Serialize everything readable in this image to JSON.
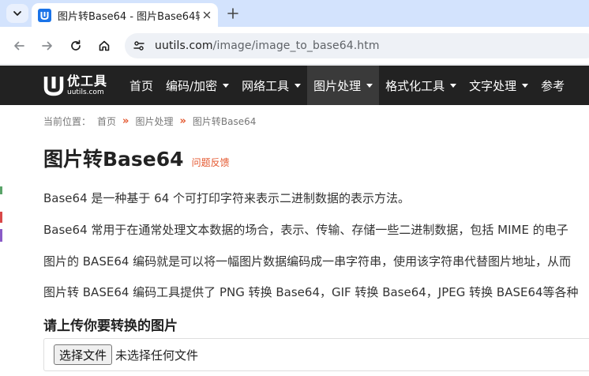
{
  "browser": {
    "tab": {
      "title": "图片转Base64 - 图片Base64转"
    },
    "url": {
      "host": "uutils.com",
      "path": "/image/image_to_base64.htm"
    }
  },
  "site": {
    "logo": {
      "cn": "优工具",
      "en": "uutils.com"
    },
    "menu": [
      {
        "label": "首页",
        "has_dropdown": false,
        "active": false
      },
      {
        "label": "编码/加密",
        "has_dropdown": true,
        "active": false
      },
      {
        "label": "网络工具",
        "has_dropdown": true,
        "active": false
      },
      {
        "label": "图片处理",
        "has_dropdown": true,
        "active": true
      },
      {
        "label": "格式化工具",
        "has_dropdown": true,
        "active": false
      },
      {
        "label": "文字处理",
        "has_dropdown": true,
        "active": false
      },
      {
        "label": "参考",
        "has_dropdown": false,
        "active": false
      }
    ]
  },
  "breadcrumb": {
    "prefix": "当前位置：",
    "items": [
      "首页",
      "图片处理",
      "图片转Base64"
    ],
    "separator": "»"
  },
  "main": {
    "title": "图片转Base64",
    "feedback_link": "问题反馈",
    "paragraphs": [
      "Base64 是一种基于 64 个可打印字符来表示二进制数据的表示方法。",
      "Base64 常用于在通常处理文本数据的场合，表示、传输、存储一些二进制数据，包括 MIME 的电子",
      "图片的 BASE64 编码就是可以将一幅图片数据编码成一串字符串，使用该字符串代替图片地址，从而",
      "图片转 BASE64 编码工具提供了 PNG 转换 Base64，GIF 转换 Base64，JPEG 转换 BASE64等各种"
    ],
    "upload_heading": "请上传你要转换的图片",
    "file_input": {
      "button_label": "选择文件",
      "status": "未选择任何文件"
    }
  },
  "colors": {
    "nav_bg": "#222222",
    "nav_active_bg": "#3a3a3a",
    "accent": "#e4572e",
    "tabstrip_bg": "#d3e3fd"
  }
}
